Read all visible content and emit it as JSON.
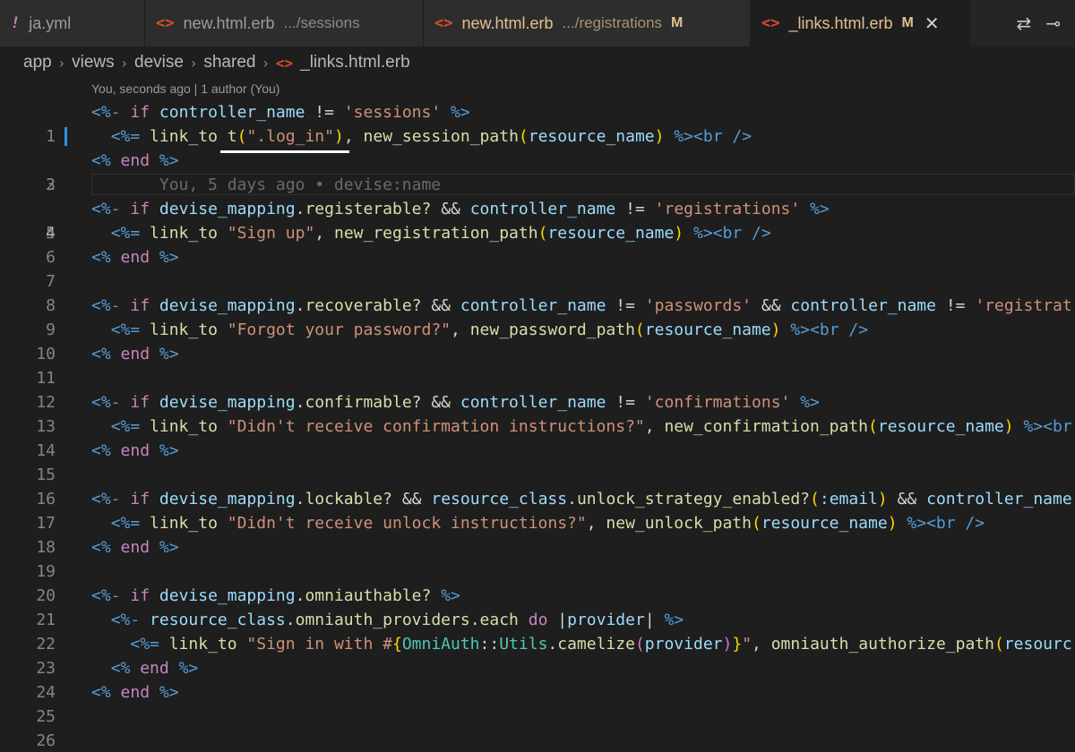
{
  "tabs": [
    {
      "icon": "!",
      "name": "ja.yml",
      "desc": "",
      "mod": ""
    },
    {
      "icon": "<>",
      "name": "new.html.erb",
      "desc": ".../sessions",
      "mod": ""
    },
    {
      "icon": "<>",
      "name": "new.html.erb",
      "desc": ".../registrations",
      "mod": "M"
    },
    {
      "icon": "<>",
      "name": "_links.html.erb",
      "desc": "",
      "mod": "M",
      "close": "✕"
    }
  ],
  "breadcrumb": [
    "app",
    "views",
    "devise",
    "shared",
    "_links.html.erb"
  ],
  "breadcrumb_sep": "›",
  "codelens": "You, seconds ago | 1 author (You)",
  "blame": "You, 5 days ago • devise:name",
  "line_numbers": [
    "1",
    "2",
    "3",
    "4",
    "5",
    "6",
    "7",
    "8",
    "9",
    "10",
    "11",
    "12",
    "13",
    "14",
    "15",
    "16",
    "17",
    "18",
    "19",
    "20",
    "21",
    "22",
    "23",
    "24",
    "25",
    "26"
  ],
  "code": {
    "l1_open": "<%-",
    "if": "if",
    "controller_name": "controller_name",
    "neq": "!=",
    "s_sessions": "'sessions'",
    "close_dash": "%>",
    "l2_open": "<%=",
    "link_to": "link_to",
    "t": "t",
    "lp": "(",
    "s_log_in": "\".log_in\"",
    "rp": ")",
    "comma": ",",
    "new_session_path": "new_session_path",
    "resource_name": "resource_name",
    "close": "%>",
    "br": "<br />",
    "end_open": "<%",
    "end": "end",
    "devise_mapping": "devise_mapping",
    "dot": ".",
    "registerable": "registerable?",
    "and": "&&",
    "s_registrations": "'registrations'",
    "s_sign_up": "\"Sign up\"",
    "new_registration_path": "new_registration_path",
    "recoverable": "recoverable?",
    "s_passwords": "'passwords'",
    "s_registrat": "'registrat",
    "s_forgot": "\"Forgot your password?\"",
    "new_password_path": "new_password_path",
    "confirmable": "confirmable?",
    "s_confirmations": "'confirmations'",
    "s_didnt_confirm": "\"Didn't receive confirmation instructions?\"",
    "new_confirmation_path": "new_confirmation_path",
    "br_cut": "<br",
    "lockable": "lockable?",
    "resource_class": "resource_class",
    "unlock_strategy_enabled": "unlock_strategy_enabled?",
    "sym_email": ":email",
    "controller_name_cut": "controller_name",
    "s_didnt_unlock": "\"Didn't receive unlock instructions?\"",
    "new_unlock_path": "new_unlock_path",
    "omniauthable": "omniauthable?",
    "omniauth_providers": "omniauth_providers",
    "each": "each",
    "do": "do",
    "provider": "provider",
    "pipe": "|",
    "s_sign_in_with": "\"Sign in with #",
    "lb": "{",
    "omniauth_const": "OmniAuth",
    "colons": "::",
    "utils": "Utils",
    "camelize": "camelize",
    "rb": "}",
    "dq": "\"",
    "omniauth_authorize_path": "omniauth_authorize_path",
    "resourc": "resourc"
  },
  "tab_actions": [
    "⇄",
    "⊸",
    "⋯"
  ]
}
